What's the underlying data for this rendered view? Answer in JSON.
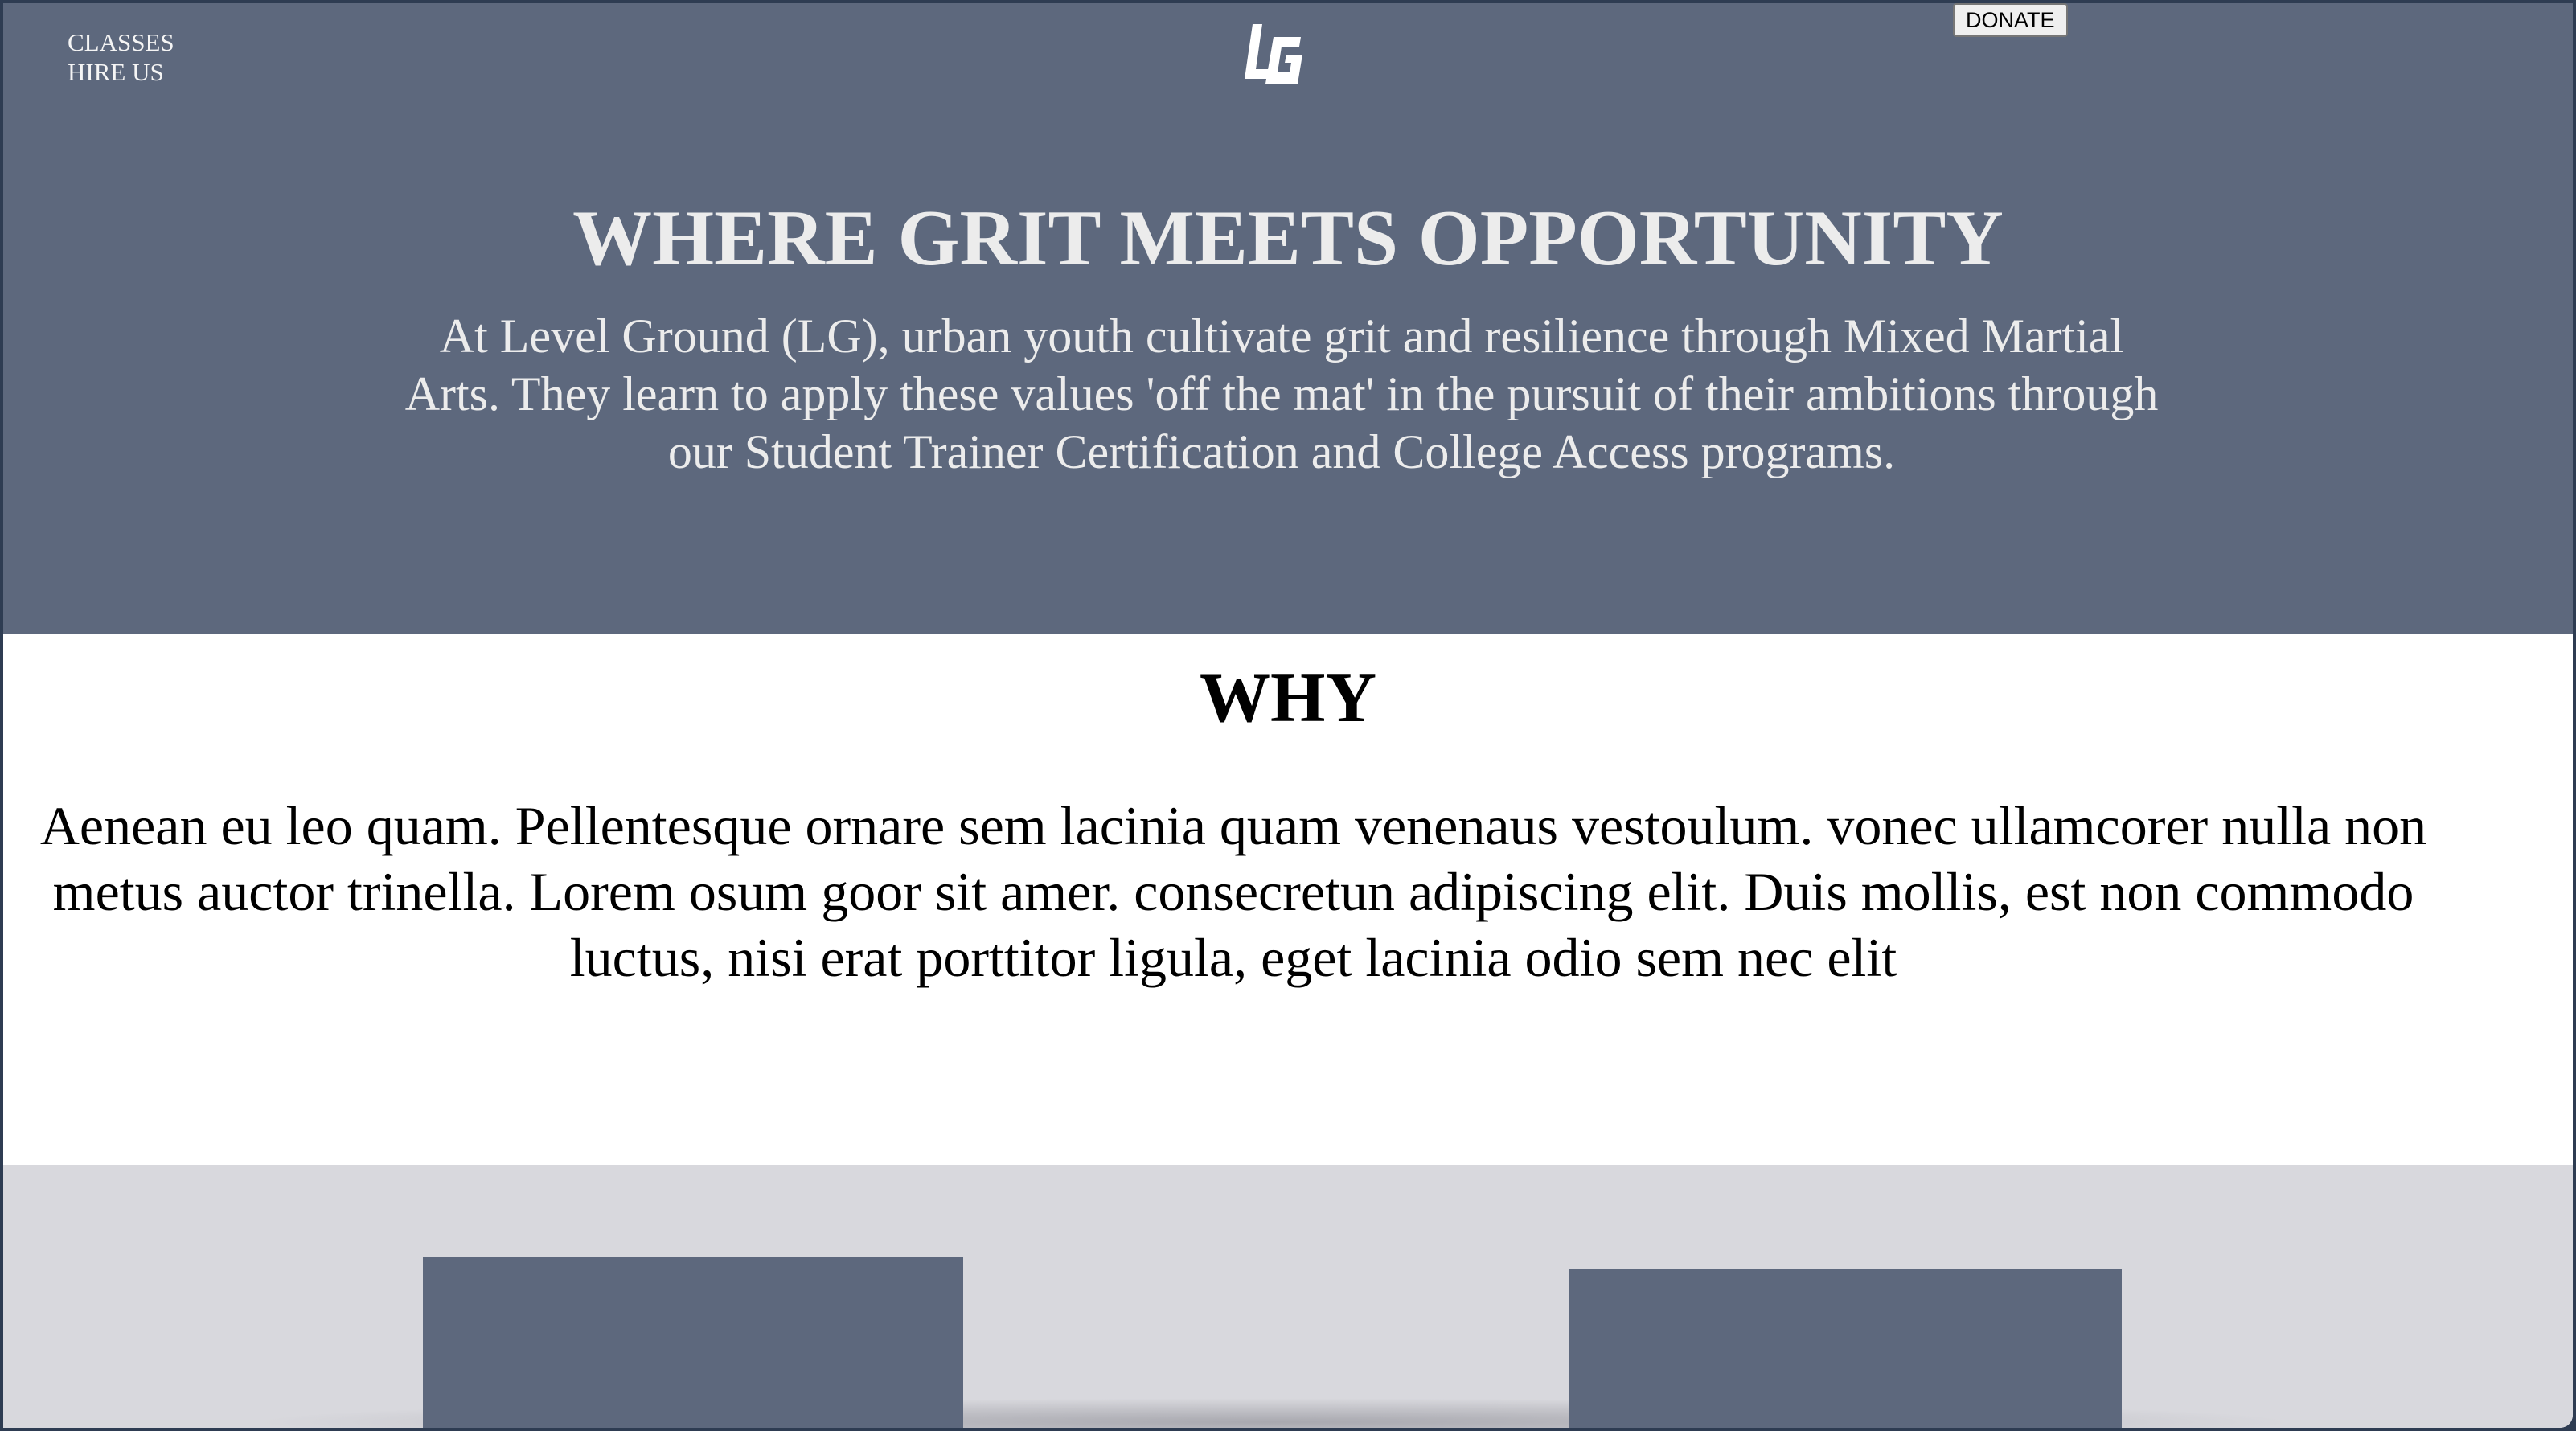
{
  "nav": {
    "items": [
      {
        "label": "CLASSES"
      },
      {
        "label": "HIRE US"
      }
    ]
  },
  "logo": {
    "text": "LG"
  },
  "donate_label": "DONATE",
  "hero": {
    "title": "WHERE GRIT MEETS OPPORTUNITY",
    "text": "At Level Ground (LG), urban youth cultivate grit and resilience through Mixed Martial Arts. They learn to apply these values 'off the mat' in the pursuit of their ambitions through our Student Trainer Certification and College Access programs."
  },
  "why": {
    "title": "WHY",
    "text": "Aenean eu leo quam. Pellentesque ornare sem lacinia quam venenaus vestoulum. vonec ullamcorer nulla non metus auctor trinella. Lorem osum goor sit amer. consecretun adipiscing elit. Duis mollis, est non commodo luctus, nisi erat porttitor ligula, eget lacinia odio sem nec elit"
  },
  "colors": {
    "hero_bg": "#5d687d",
    "hero_text": "#ececec",
    "cards_bg": "#d8d8dd",
    "card_bg": "#5d687d",
    "frame": "#2e3c52"
  }
}
